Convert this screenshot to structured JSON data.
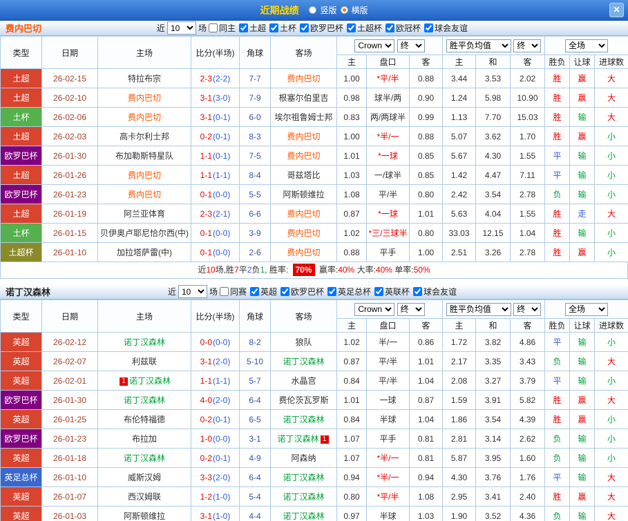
{
  "topbar": {
    "title": "近期战绩",
    "vertical_label": "竖版",
    "horizontal_label": "横版",
    "selected_mode": "横版",
    "close_label": "✕"
  },
  "sections": [
    {
      "team": "费内巴切",
      "team_color": "#ff5500",
      "focal_color": "#ff5500",
      "filter": {
        "near": "近",
        "count": "10",
        "games": "场",
        "checkboxes": [
          {
            "label": "同主",
            "checked": false
          },
          {
            "label": "土超",
            "checked": true
          },
          {
            "label": "土杯",
            "checked": true
          },
          {
            "label": "欧罗巴杯",
            "checked": true
          },
          {
            "label": "土超杯",
            "checked": true
          },
          {
            "label": "欧冠杯",
            "checked": true
          },
          {
            "label": "球会友谊",
            "checked": true
          }
        ]
      },
      "header": {
        "type": "类型",
        "date": "日期",
        "home": "主场",
        "score": "比分(半场)",
        "corner": "角球",
        "away": "客场",
        "bookmaker": "Crown",
        "final1": "终",
        "avg": "胜平负均值",
        "final2": "终",
        "full": "全场",
        "sub_home": "主",
        "sub_pan": "盘口",
        "sub_away": "客",
        "sub_h": "主",
        "sub_d": "和",
        "sub_a": "客",
        "sub_result": "胜负",
        "sub_handicap": "让球",
        "sub_goals": "进球数"
      },
      "rows": [
        {
          "lg": "土超",
          "lgc": "#d9442f",
          "date": "26-02-15",
          "home": "特拉布宗",
          "hf": false,
          "ft": "2-3",
          "ht": "(2-2)",
          "cr": "7-7",
          "away": "费内巴切",
          "af": true,
          "o1": "1.00",
          "pan": "*平/半",
          "o2": "0.88",
          "h": "3.44",
          "d": "3.53",
          "a": "2.02",
          "r1": "胜",
          "r2": "赢",
          "r3": "大"
        },
        {
          "lg": "土超",
          "lgc": "#d9442f",
          "date": "26-02-10",
          "home": "费内巴切",
          "hf": true,
          "ft": "3-1",
          "ht": "(3-0)",
          "cr": "7-9",
          "away": "根塞尔伯里吉",
          "af": false,
          "o1": "0.98",
          "pan": "球半/两",
          "o2": "0.90",
          "h": "1.24",
          "d": "5.98",
          "a": "10.90",
          "r1": "胜",
          "r2": "赢",
          "r3": "大"
        },
        {
          "lg": "土杯",
          "lgc": "#55b14d",
          "date": "26-02-06",
          "home": "费内巴切",
          "hf": true,
          "ft": "3-1",
          "ht": "(0-1)",
          "cr": "6-0",
          "away": "埃尔祖鲁姆士邦",
          "af": false,
          "o1": "0.83",
          "pan": "两/两球半",
          "o2": "0.99",
          "h": "1.13",
          "d": "7.70",
          "a": "15.03",
          "r1": "胜",
          "r2": "输",
          "r3": "大"
        },
        {
          "lg": "土超",
          "lgc": "#d9442f",
          "date": "26-02-03",
          "home": "高卡尔利士邦",
          "hf": false,
          "ft": "0-2",
          "ht": "(0-1)",
          "cr": "8-3",
          "away": "费内巴切",
          "af": true,
          "o1": "1.00",
          "pan": "*半/一",
          "o2": "0.88",
          "h": "5.07",
          "d": "3.62",
          "a": "1.70",
          "r1": "胜",
          "r2": "赢",
          "r3": "小"
        },
        {
          "lg": "欧罗巴杯",
          "lgc": "#800080",
          "date": "26-01-30",
          "home": "布加勒斯特星队",
          "hf": false,
          "ft": "1-1",
          "ht": "(0-1)",
          "cr": "7-5",
          "away": "费内巴切",
          "af": true,
          "o1": "1.01",
          "pan": "*一球",
          "o2": "0.85",
          "h": "5.67",
          "d": "4.30",
          "a": "1.55",
          "r1": "平",
          "r2": "输",
          "r3": "小"
        },
        {
          "lg": "土超",
          "lgc": "#d9442f",
          "date": "26-01-26",
          "home": "费内巴切",
          "hf": true,
          "ft": "1-1",
          "ht": "(1-1)",
          "cr": "8-4",
          "away": "哥兹塔比",
          "af": false,
          "o1": "1.03",
          "pan": "一/球半",
          "o2": "0.85",
          "h": "1.42",
          "d": "4.47",
          "a": "7.11",
          "r1": "平",
          "r2": "输",
          "r3": "小"
        },
        {
          "lg": "欧罗巴杯",
          "lgc": "#800080",
          "date": "26-01-23",
          "home": "费内巴切",
          "hf": true,
          "ft": "0-1",
          "ht": "(0-0)",
          "cr": "5-5",
          "away": "阿斯顿维拉",
          "af": false,
          "o1": "1.08",
          "pan": "平/半",
          "o2": "0.80",
          "h": "2.42",
          "d": "3.54",
          "a": "2.78",
          "r1": "负",
          "r2": "输",
          "r3": "小"
        },
        {
          "lg": "土超",
          "lgc": "#d9442f",
          "date": "26-01-19",
          "home": "阿兰亚体育",
          "hf": false,
          "ft": "2-3",
          "ht": "(2-1)",
          "cr": "6-6",
          "away": "费内巴切",
          "af": true,
          "o1": "0.87",
          "pan": "*一球",
          "o2": "1.01",
          "h": "5.63",
          "d": "4.04",
          "a": "1.55",
          "r1": "胜",
          "r2": "走",
          "r3": "大"
        },
        {
          "lg": "土杯",
          "lgc": "#55b14d",
          "date": "26-01-15",
          "home": "贝伊奥卢耶尼恰尔西(中)",
          "hf": false,
          "ft": "0-1",
          "ht": "(0-0)",
          "cr": "3-9",
          "away": "费内巴切",
          "af": true,
          "o1": "1.02",
          "pan": "*三/三球半",
          "o2": "0.80",
          "h": "33.03",
          "d": "12.15",
          "a": "1.04",
          "r1": "胜",
          "r2": "输",
          "r3": "小"
        },
        {
          "lg": "土超杯",
          "lgc": "#8a8a2a",
          "date": "26-01-10",
          "home": "加拉塔萨雷(中)",
          "hf": false,
          "ft": "0-1",
          "ht": "(0-0)",
          "cr": "2-6",
          "away": "费内巴切",
          "af": true,
          "o1": "0.88",
          "pan": "平手",
          "o2": "1.00",
          "h": "2.51",
          "d": "3.26",
          "a": "2.78",
          "r1": "胜",
          "r2": "赢",
          "r3": "小"
        }
      ],
      "summary": {
        "prefix": [
          {
            "t": "近"
          },
          {
            "t": "10",
            "c": "r"
          },
          {
            "t": "场,胜"
          },
          {
            "t": "7",
            "c": "r"
          },
          {
            "t": "平"
          },
          {
            "t": "2",
            "c": "b"
          },
          {
            "t": "负"
          },
          {
            "t": "1",
            "c": "g"
          },
          {
            "t": ", 胜率: "
          }
        ],
        "badge": "70%",
        "tail": [
          {
            "t": " 赢率:"
          },
          {
            "t": "40%",
            "c": "r"
          },
          {
            "t": " 大率:"
          },
          {
            "t": "40%",
            "c": "r"
          },
          {
            "t": " 单率:"
          },
          {
            "t": "50%",
            "c": "r"
          }
        ]
      }
    },
    {
      "team": "诺丁汉森林",
      "team_color": "#222222",
      "focal_color": "#00a13a",
      "filter": {
        "near": "近",
        "count": "10",
        "games": "场",
        "checkboxes": [
          {
            "label": "同赛",
            "checked": false
          },
          {
            "label": "英超",
            "checked": true
          },
          {
            "label": "欧罗巴杯",
            "checked": true
          },
          {
            "label": "英足总杯",
            "checked": true
          },
          {
            "label": "英联杯",
            "checked": true
          },
          {
            "label": "球会友谊",
            "checked": true
          }
        ]
      },
      "header": {
        "type": "类型",
        "date": "日期",
        "home": "主场",
        "score": "比分(半场)",
        "corner": "角球",
        "away": "客场",
        "bookmaker": "Crown",
        "final1": "终",
        "avg": "胜平负均值",
        "final2": "终",
        "full": "全场",
        "sub_home": "主",
        "sub_pan": "盘口",
        "sub_away": "客",
        "sub_h": "主",
        "sub_d": "和",
        "sub_a": "客",
        "sub_result": "胜负",
        "sub_handicap": "让球",
        "sub_goals": "进球数"
      },
      "rows": [
        {
          "lg": "英超",
          "lgc": "#d9442f",
          "date": "26-02-12",
          "home": "诺丁汉森林",
          "hf": true,
          "ft": "0-0",
          "ht": "(0-0)",
          "cr": "8-2",
          "away": "狼队",
          "af": false,
          "o1": "1.02",
          "pan": "半/一",
          "o2": "0.86",
          "h": "1.72",
          "d": "3.82",
          "a": "4.86",
          "r1": "平",
          "r2": "输",
          "r3": "小"
        },
        {
          "lg": "英超",
          "lgc": "#d9442f",
          "date": "26-02-07",
          "home": "利兹联",
          "hf": false,
          "ft": "3-1",
          "ht": "(2-0)",
          "cr": "5-10",
          "away": "诺丁汉森林",
          "af": true,
          "o1": "0.87",
          "pan": "平/半",
          "o2": "1.01",
          "h": "2.17",
          "d": "3.35",
          "a": "3.43",
          "r1": "负",
          "r2": "输",
          "r3": "大"
        },
        {
          "lg": "英超",
          "lgc": "#d9442f",
          "date": "26-02-01",
          "home": "诺丁汉森林",
          "hf": true,
          "hb": "1",
          "ft": "1-1",
          "ht": "(1-1)",
          "cr": "5-7",
          "away": "水晶宫",
          "af": false,
          "o1": "0.84",
          "pan": "平/半",
          "o2": "1.04",
          "h": "2.08",
          "d": "3.27",
          "a": "3.79",
          "r1": "平",
          "r2": "输",
          "r3": "小"
        },
        {
          "lg": "欧罗巴杯",
          "lgc": "#800080",
          "date": "26-01-30",
          "home": "诺丁汉森林",
          "hf": true,
          "ft": "4-0",
          "ht": "(2-0)",
          "cr": "6-4",
          "away": "费伦茨瓦罗斯",
          "af": false,
          "o1": "1.01",
          "pan": "一球",
          "o2": "0.87",
          "h": "1.59",
          "d": "3.91",
          "a": "5.82",
          "r1": "胜",
          "r2": "赢",
          "r3": "大"
        },
        {
          "lg": "英超",
          "lgc": "#d9442f",
          "date": "26-01-25",
          "home": "布伦特福德",
          "hf": false,
          "ft": "0-2",
          "ht": "(0-1)",
          "cr": "6-5",
          "away": "诺丁汉森林",
          "af": true,
          "o1": "0.84",
          "pan": "半球",
          "o2": "1.04",
          "h": "1.86",
          "d": "3.54",
          "a": "4.39",
          "r1": "胜",
          "r2": "赢",
          "r3": "小"
        },
        {
          "lg": "欧罗巴杯",
          "lgc": "#800080",
          "date": "26-01-23",
          "home": "布拉加",
          "hf": false,
          "ft": "1-0",
          "ht": "(0-0)",
          "cr": "3-1",
          "away": "诺丁汉森林",
          "af": true,
          "ab": "1",
          "o1": "1.07",
          "pan": "平手",
          "o2": "0.81",
          "h": "2.81",
          "d": "3.14",
          "a": "2.62",
          "r1": "负",
          "r2": "输",
          "r3": "小"
        },
        {
          "lg": "英超",
          "lgc": "#d9442f",
          "date": "26-01-18",
          "home": "诺丁汉森林",
          "hf": true,
          "ft": "0-2",
          "ht": "(0-1)",
          "cr": "4-9",
          "away": "阿森纳",
          "af": false,
          "o1": "1.07",
          "pan": "*半/一",
          "o2": "0.81",
          "h": "5.87",
          "d": "3.95",
          "a": "1.60",
          "r1": "负",
          "r2": "输",
          "r3": "小"
        },
        {
          "lg": "英足总杯",
          "lgc": "#3a67cd",
          "date": "26-01-10",
          "home": "威斯汉姆",
          "hf": false,
          "ft": "3-3",
          "ht": "(2-0)",
          "cr": "6-4",
          "away": "诺丁汉森林",
          "af": true,
          "o1": "0.94",
          "pan": "*半/一",
          "o2": "0.94",
          "h": "4.30",
          "d": "3.76",
          "a": "1.76",
          "r1": "平",
          "r2": "输",
          "r3": "大"
        },
        {
          "lg": "英超",
          "lgc": "#d9442f",
          "date": "26-01-07",
          "home": "西汉姆联",
          "hf": false,
          "ft": "1-2",
          "ht": "(1-0)",
          "cr": "5-4",
          "away": "诺丁汉森林",
          "af": true,
          "o1": "0.80",
          "pan": "*平/半",
          "o2": "1.08",
          "h": "2.95",
          "d": "3.41",
          "a": "2.40",
          "r1": "胜",
          "r2": "赢",
          "r3": "大"
        },
        {
          "lg": "英超",
          "lgc": "#d9442f",
          "date": "26-01-03",
          "home": "阿斯顿维拉",
          "hf": false,
          "ft": "3-1",
          "ht": "(1-0)",
          "cr": "4-4",
          "away": "诺丁汉森林",
          "af": true,
          "o1": "0.97",
          "pan": "半球",
          "o2": "1.03",
          "h": "1.90",
          "d": "3.52",
          "a": "4.36",
          "r1": "负",
          "r2": "输",
          "r3": "大"
        }
      ]
    }
  ]
}
